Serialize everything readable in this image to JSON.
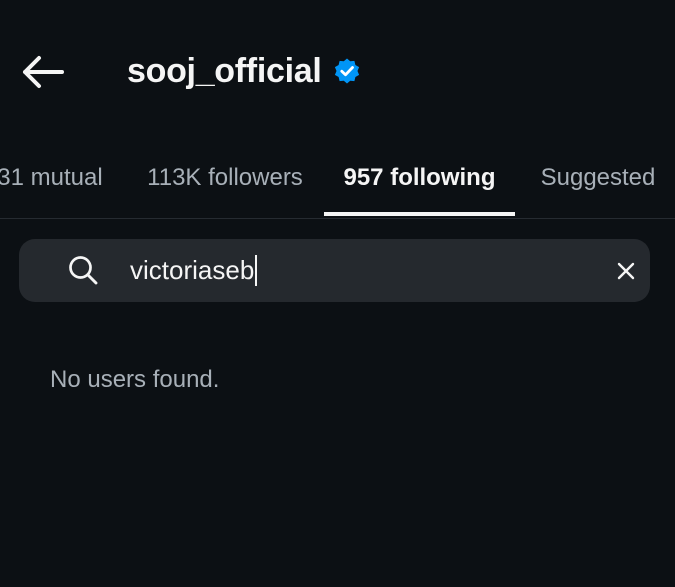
{
  "header": {
    "title": "sooj_official",
    "back_icon": "arrow-left-icon",
    "verified_icon": "verified-badge-icon",
    "verified_color": "#0095f6"
  },
  "tabs": [
    {
      "label": "31 mutual",
      "active": false
    },
    {
      "label": "113K followers",
      "active": false
    },
    {
      "label": "957 following",
      "active": true
    },
    {
      "label": "Suggested",
      "active": false
    }
  ],
  "search": {
    "value": "victoriaseb",
    "placeholder": "",
    "search_icon": "search-icon",
    "clear_icon": "close-icon"
  },
  "results": {
    "empty_message": "No users found."
  },
  "colors": {
    "background": "#0c1014",
    "search_background": "#25292e",
    "primary_text": "#f5f5f5",
    "secondary_text": "#a8b0b8",
    "accent": "#0095f6"
  }
}
